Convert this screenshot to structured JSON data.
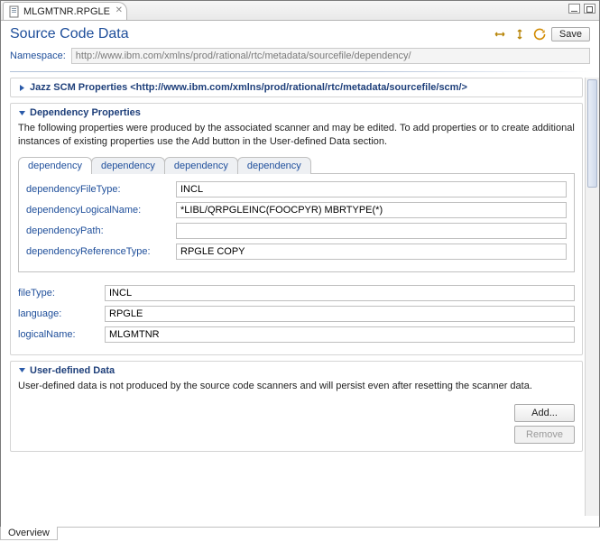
{
  "tab": {
    "file_name": "MLGMTNR.RPGLE"
  },
  "header": {
    "title": "Source Code Data",
    "save_label": "Save",
    "namespace_label": "Namespace:",
    "namespace_value": "http://www.ibm.com/xmlns/prod/rational/rtc/metadata/sourcefile/dependency/"
  },
  "sections": {
    "scm": {
      "title": "Jazz SCM Properties <http://www.ibm.com/xmlns/prod/rational/rtc/metadata/sourcefile/scm/>"
    },
    "dependency": {
      "title": "Dependency Properties",
      "desc": "The following properties were produced by the associated scanner and may be edited.  To add properties or to create additional instances of existing properties use the Add button in the User-defined Data section.",
      "tabs": [
        "dependency",
        "dependency",
        "dependency",
        "dependency"
      ],
      "fields": {
        "file_type_label": "dependencyFileType:",
        "file_type_value": "INCL",
        "logical_name_label": "dependencyLogicalName:",
        "logical_name_value": "*LIBL/QRPGLEINC(FOOCPYR) MBRTYPE(*)",
        "path_label": "dependencyPath:",
        "path_value": "",
        "ref_type_label": "dependencyReferenceType:",
        "ref_type_value": "RPGLE COPY"
      },
      "file_block": {
        "file_type_label": "fileType:",
        "file_type_value": "INCL",
        "language_label": "language:",
        "language_value": "RPGLE",
        "logical_name_label": "logicalName:",
        "logical_name_value": "MLGMTNR"
      }
    },
    "user_defined": {
      "title": "User-defined Data",
      "desc": "User-defined data is not produced by the source code scanners and will persist even after resetting the scanner data.",
      "add_label": "Add...",
      "remove_label": "Remove"
    }
  },
  "bottom": {
    "overview_label": "Overview"
  }
}
